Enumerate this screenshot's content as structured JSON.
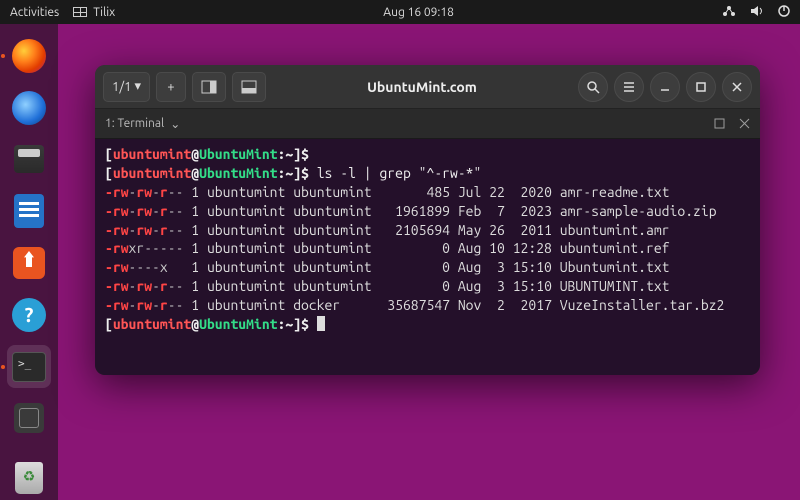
{
  "topbar": {
    "activities": "Activities",
    "app": "Tilix",
    "clock": "Aug 16  09:18"
  },
  "window": {
    "session": "1/1",
    "session_caret": "▾",
    "title": "UbuntuMint.com",
    "tab_label": "1: Terminal",
    "tab_caret": "⌄"
  },
  "prompt": {
    "open": "[",
    "user": "ubuntumint",
    "at": "@",
    "host": "UbuntuMint",
    "path": ":~",
    "close": "]",
    "sym": "$"
  },
  "command": "ls -l | grep \"^-rw-*\"",
  "rows": [
    {
      "perm": "-rw-rw-r--",
      "perm_hl": [
        [
          0,
          3
        ],
        [
          4,
          6
        ],
        [
          7,
          8
        ]
      ],
      "links": "1",
      "owner": "ubuntumint",
      "group": "ubuntumint",
      "size": "485",
      "date": "Jul 22  2020",
      "name": "amr-readme.txt"
    },
    {
      "perm": "-rw-rw-r--",
      "perm_hl": [
        [
          0,
          3
        ],
        [
          4,
          6
        ],
        [
          7,
          8
        ]
      ],
      "links": "1",
      "owner": "ubuntumint",
      "group": "ubuntumint",
      "size": "1961899",
      "date": "Feb  7  2023",
      "name": "amr-sample-audio.zip"
    },
    {
      "perm": "-rw-rw-r--",
      "perm_hl": [
        [
          0,
          3
        ],
        [
          4,
          6
        ],
        [
          7,
          8
        ]
      ],
      "links": "1",
      "owner": "ubuntumint",
      "group": "ubuntumint",
      "size": "2105694",
      "date": "May 26  2011",
      "name": "ubuntumint.amr"
    },
    {
      "perm": "-rwxr-----",
      "perm_hl": [
        [
          0,
          3
        ]
      ],
      "links": "1",
      "owner": "ubuntumint",
      "group": "ubuntumint",
      "size": "0",
      "date": "Aug 10 12:28",
      "name": "ubuntumint.ref"
    },
    {
      "perm": "-rw----x",
      "perm_hl": [
        [
          0,
          3
        ]
      ],
      "links": "1",
      "owner": "ubuntumint",
      "group": "ubuntumint",
      "size": "0",
      "date": "Aug  3 15:10",
      "name": "Ubuntumint.txt"
    },
    {
      "perm": "-rw-rw-r--",
      "perm_hl": [
        [
          0,
          3
        ],
        [
          4,
          6
        ],
        [
          7,
          8
        ]
      ],
      "links": "1",
      "owner": "ubuntumint",
      "group": "ubuntumint",
      "size": "0",
      "date": "Aug  3 15:10",
      "name": "UBUNTUMINT.txt"
    },
    {
      "perm": "-rw-rw-r--",
      "perm_hl": [
        [
          0,
          3
        ],
        [
          4,
          6
        ],
        [
          7,
          8
        ]
      ],
      "links": "1",
      "owner": "ubuntumint",
      "group": "docker",
      "size": "35687547",
      "date": "Nov  2  2017",
      "name": "VuzeInstaller.tar.bz2"
    }
  ],
  "col_widths": {
    "perm": 10,
    "links": 2,
    "owner": 11,
    "group": 11,
    "size": 9,
    "date": 13
  }
}
